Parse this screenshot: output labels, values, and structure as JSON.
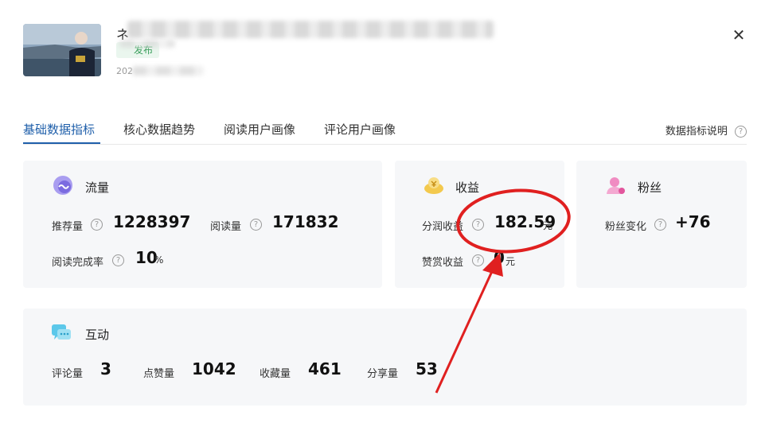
{
  "article": {
    "title_visible": "ネ",
    "status": "发布",
    "date_visible": "202"
  },
  "close": {
    "glyph": "✕"
  },
  "tabs": [
    {
      "label": "基础数据指标",
      "active": true
    },
    {
      "label": "核心数据趋势",
      "active": false
    },
    {
      "label": "阅读用户画像",
      "active": false
    },
    {
      "label": "评论用户画像",
      "active": false
    }
  ],
  "help": {
    "label": "数据指标说明",
    "icon": "question-circle-icon"
  },
  "traffic": {
    "title": "流量",
    "icon": "traffic-icon",
    "recommend_label": "推荐量",
    "recommend_value": "1228397",
    "read_label": "阅读量",
    "read_value": "171832",
    "completion_label": "阅读完成率",
    "completion_value": "10",
    "completion_unit": "%"
  },
  "income": {
    "title": "收益",
    "icon": "income-icon",
    "share_label": "分润收益",
    "share_value": "182.59",
    "share_unit": "元",
    "tip_label": "赞赏收益",
    "tip_value": "0",
    "tip_unit": "元"
  },
  "fans": {
    "title": "粉丝",
    "icon": "fans-icon",
    "change_label": "粉丝变化",
    "change_value": "+76"
  },
  "interaction": {
    "title": "互动",
    "icon": "interaction-icon",
    "comment_label": "评论量",
    "comment_value": "3",
    "like_label": "点赞量",
    "like_value": "1042",
    "fav_label": "收藏量",
    "fav_value": "461",
    "share_label": "分享量",
    "share_value": "53"
  },
  "colors": {
    "accent": "#1f5faa",
    "card_bg": "#f6f7f9",
    "annotation_red": "#e02020",
    "status_green": "#2e9a52"
  }
}
